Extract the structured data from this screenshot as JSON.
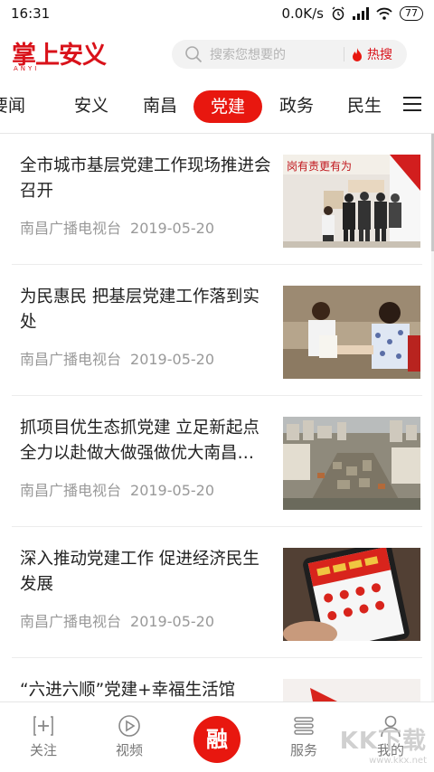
{
  "status": {
    "time": "16:31",
    "speed": "0.0K/s",
    "battery": "77"
  },
  "logo": {
    "text": "掌上安义",
    "sub": "ANYI"
  },
  "search": {
    "placeholder": "搜索您想要的",
    "hot_label": "热搜"
  },
  "tabs": [
    {
      "label": "要闻"
    },
    {
      "label": "安义"
    },
    {
      "label": "南昌"
    },
    {
      "label": "党建",
      "active": true
    },
    {
      "label": "政务"
    },
    {
      "label": "民生"
    }
  ],
  "articles": [
    {
      "title": "全市城市基层党建工作现场推进会召开",
      "source": "南昌广播电视台",
      "date": "2019-05-20",
      "image": "meeting-photo",
      "banner": "岗有责更有为"
    },
    {
      "title": "为民惠民 把基层党建工作落到实处",
      "source": "南昌广播电视台",
      "date": "2019-05-20",
      "image": "blood-pressure-photo"
    },
    {
      "title": "抓项目优生态抓党建 立足新起点全力以赴做大做强做优大南昌…",
      "source": "南昌广播电视台",
      "date": "2019-05-20",
      "image": "aerial-city-photo"
    },
    {
      "title": "深入推动党建工作 促进经济民生发展",
      "source": "南昌广播电视台",
      "date": "2019-05-20",
      "image": "phone-app-photo"
    },
    {
      "title": "“六进六顺”党建+幸福生活馆",
      "source": "",
      "date": "",
      "image": "flag-photo"
    }
  ],
  "bottom_nav": [
    {
      "label": "关注",
      "icon": "plus-box-icon"
    },
    {
      "label": "视频",
      "icon": "play-circle-icon"
    },
    {
      "label": "融",
      "icon": "rong-center-button"
    },
    {
      "label": "服务",
      "icon": "list-icon"
    },
    {
      "label": "我的",
      "icon": "person-icon"
    }
  ],
  "watermark": {
    "big": "KK下载",
    "small": "www.kkx.net"
  },
  "colors": {
    "accent": "#e8170f",
    "meta": "#999999"
  }
}
